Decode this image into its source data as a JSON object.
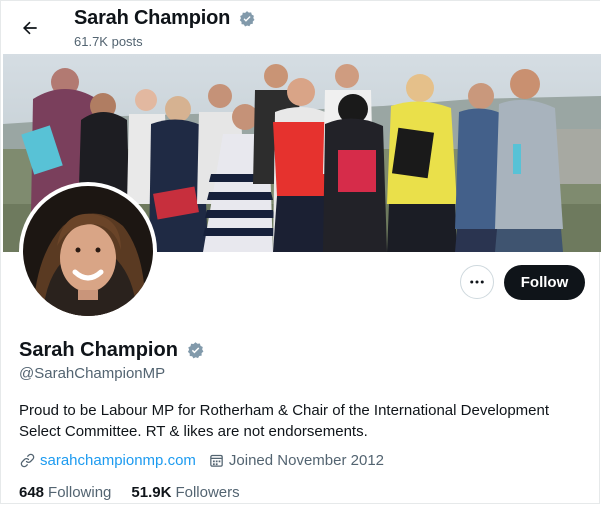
{
  "header": {
    "name": "Sarah Champion",
    "posts": "61.7K posts",
    "back_icon": "arrow-left-icon",
    "verified_icon": "verified-badge-icon"
  },
  "actions": {
    "more_icon": "ellipsis-icon",
    "follow_label": "Follow"
  },
  "profile": {
    "name": "Sarah Champion",
    "handle": "@SarahChampionMP",
    "bio": "Proud to be Labour MP for Rotherham & Chair of the International Development Select Committee. RT & likes are not endorsements.",
    "website": "sarahchampionmp.com",
    "website_icon": "link-icon",
    "joined": "Joined November 2012",
    "joined_icon": "calendar-icon"
  },
  "stats": {
    "following_count": "648",
    "following_label": "Following",
    "followers_count": "51.9K",
    "followers_label": "Followers"
  },
  "colors": {
    "accent": "#1d9bf0",
    "text": "#0f1419",
    "muted": "#536471",
    "follow_bg": "#0f1419"
  }
}
